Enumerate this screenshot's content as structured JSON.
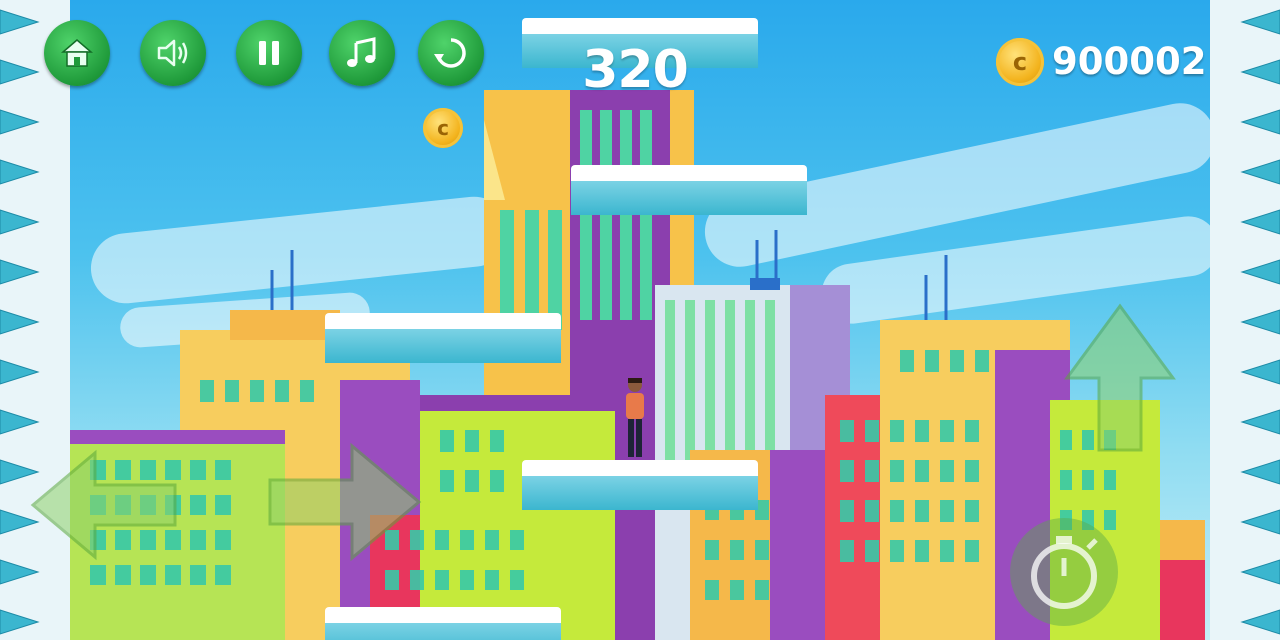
{
  "hud": {
    "buttons": [
      {
        "name": "home-button",
        "icon": "home-icon"
      },
      {
        "name": "sound-button",
        "icon": "speaker-icon"
      },
      {
        "name": "pause-button",
        "icon": "pause-icon"
      },
      {
        "name": "music-button",
        "icon": "music-note-icon"
      },
      {
        "name": "restart-button",
        "icon": "restart-icon"
      }
    ],
    "score": "320",
    "coin_total": "900002",
    "coin_symbol": "c"
  },
  "controls": {
    "left_arrow": "left-arrow-icon",
    "right_arrow": "right-arrow-icon",
    "jump_arrow": "up-arrow-icon",
    "timer_button": "stopwatch-icon"
  },
  "colors": {
    "button_green": "#1f9a3a",
    "ice": "#3bb6cf",
    "coin_gold": "#f3b31d"
  }
}
